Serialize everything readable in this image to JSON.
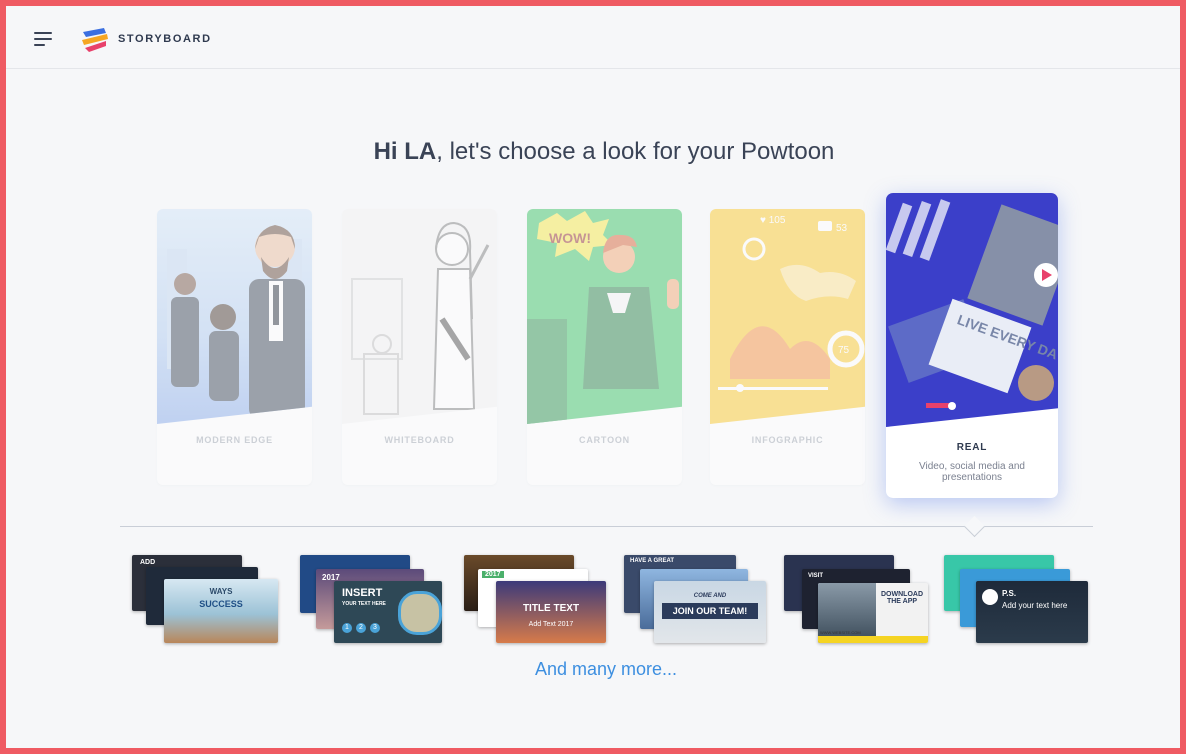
{
  "header": {
    "menu_icon": "hamburger-menu-icon",
    "logo_icon": "storyboard-logo-icon",
    "brand": "STORYBOARD"
  },
  "greeting": {
    "name": "Hi LA",
    "rest": ", let's choose a look for your Powtoon"
  },
  "styles": [
    {
      "label": "MODERN EDGE"
    },
    {
      "label": "WHITEBOARD"
    },
    {
      "label": "CARTOON",
      "art_text": "WOW!"
    },
    {
      "label": "INFOGRAPHIC",
      "art_badges": [
        "♥ 105",
        "53",
        "75"
      ]
    },
    {
      "label": "REAL",
      "description": "Video, social media and presentations",
      "art_text": "LIVE EVERY DAY"
    }
  ],
  "templates": [
    {
      "text": "SUCCESS",
      "sub": "WAYS",
      "top": "ADD"
    },
    {
      "text": "INSERT",
      "sub": "YOUR TEXT HERE",
      "top": "2017",
      "steps": [
        "1",
        "2",
        "3"
      ]
    },
    {
      "text": "TITLE TEXT",
      "sub": "Add Text 2017",
      "top": "2017"
    },
    {
      "text": "JOIN OUR TEAM!",
      "sub": "COME AND",
      "top": "HAVE A GREAT"
    },
    {
      "text": "DOWNLOAD THE APP",
      "sub": "WWW.WEBSITE.COM",
      "top": "VISIT"
    },
    {
      "text": "Add your text here",
      "sub": "P.S.",
      "top": ""
    }
  ],
  "more_link": "And many more...",
  "colors": {
    "accent": "#3d8fe0",
    "border": "#ef5b63",
    "text": "#3a4356"
  }
}
